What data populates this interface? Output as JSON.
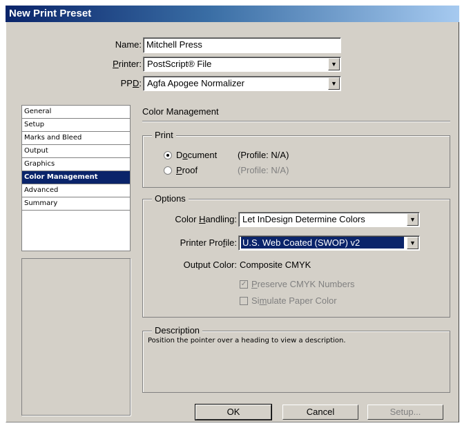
{
  "window": {
    "title": "New Print Preset"
  },
  "form": {
    "name_label": "Name:",
    "name_value": "Mitchell Press",
    "printer_label_pre": "",
    "printer_label_u": "P",
    "printer_label_post": "rinter:",
    "printer_value": "PostScript® File",
    "ppd_label_pre": "PP",
    "ppd_label_u": "D",
    "ppd_label_post": ":",
    "ppd_value": "Agfa Apogee Normalizer"
  },
  "sidebar": {
    "items": [
      {
        "label": "General"
      },
      {
        "label": "Setup"
      },
      {
        "label": "Marks and Bleed"
      },
      {
        "label": "Output"
      },
      {
        "label": "Graphics"
      },
      {
        "label": "Color Management"
      },
      {
        "label": "Advanced"
      },
      {
        "label": "Summary"
      }
    ],
    "selected_index": 5
  },
  "panel": {
    "title": "Color Management",
    "print_group": {
      "title": "Print",
      "document_pre": "D",
      "document_u": "o",
      "document_post": "cument",
      "document_profile": "(Profile: N/A)",
      "proof_pre": "",
      "proof_u": "P",
      "proof_post": "roof",
      "proof_profile": "(Profile: N/A)"
    },
    "options_group": {
      "title": "Options",
      "color_handling_pre": "Color ",
      "color_handling_u": "H",
      "color_handling_post": "andling:",
      "color_handling_value": "Let InDesign Determine Colors",
      "printer_profile_pre": "Printer Pro",
      "printer_profile_u": "f",
      "printer_profile_post": "ile:",
      "printer_profile_value": "U.S. Web Coated (SWOP) v2",
      "output_color_label": "Output Color:",
      "output_color_value": "Composite CMYK",
      "preserve_pre": "",
      "preserve_u": "P",
      "preserve_post": "reserve CMYK Numbers",
      "preserve_checked": true,
      "simulate_pre": "Si",
      "simulate_u": "m",
      "simulate_post": "ulate Paper Color",
      "simulate_checked": false
    },
    "description_group": {
      "title": "Description",
      "text": "Position the pointer over a heading to view a description."
    }
  },
  "buttons": {
    "ok": "OK",
    "cancel": "Cancel",
    "setup": "Setup..."
  },
  "colors": {
    "titlebar_start": "#0a246a",
    "titlebar_end": "#a6caf0",
    "dialog_bg": "#d4d0c8",
    "selection": "#0a246a"
  }
}
